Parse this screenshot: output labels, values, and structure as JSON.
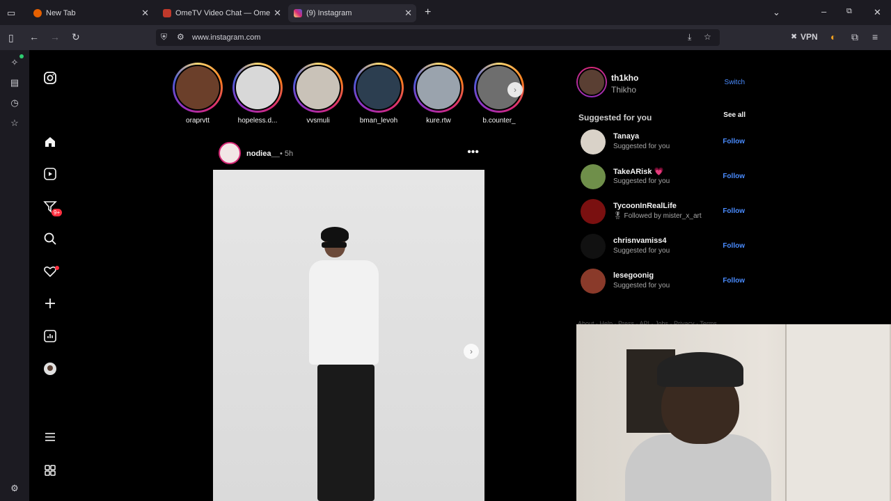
{
  "browser": {
    "tabs": [
      {
        "label": "New Tab",
        "favicon_color": "#e66000"
      },
      {
        "label": "OmeTV Video Chat — Omegle",
        "favicon_color": "#c0392b"
      },
      {
        "label": "(9) Instagram",
        "favicon_color": "#d62976"
      }
    ],
    "url": "www.instagram.com",
    "vpn_label": "VPN"
  },
  "instagram": {
    "notification_badge": "9+",
    "stories": [
      {
        "name": "oraprvtt",
        "color": "#6b3f2a"
      },
      {
        "name": "hopeless.d...",
        "color": "#d8d8d8"
      },
      {
        "name": "vvsmuli",
        "color": "#c9c2b8"
      },
      {
        "name": "bman_levoh",
        "color": "#2c3e50"
      },
      {
        "name": "kure.rtw",
        "color": "#9aa3ad"
      },
      {
        "name": "b.counter_",
        "color": "#6e6e6e"
      }
    ],
    "post": {
      "username": "nodiea__",
      "time": "• 5h"
    },
    "me": {
      "username": "th1kho",
      "full_name": "Thikho",
      "switch_label": "Switch"
    },
    "suggested": {
      "title": "Suggested for you",
      "see_all": "See all",
      "items": [
        {
          "username": "Tanaya",
          "sub": "Suggested for you",
          "follow": "Follow",
          "color": "#d9d2c8"
        },
        {
          "username": "TakeARisk 💗",
          "sub": "Suggested for you",
          "follow": "Follow",
          "color": "#6f8f4a"
        },
        {
          "username": "TycoonInRealLife",
          "sub": "🎖 Followed by mister_x_art",
          "follow": "Follow",
          "color": "#7a1010"
        },
        {
          "username": "chrisnvamiss4",
          "sub": "Suggested for you",
          "follow": "Follow",
          "color": "#111111"
        },
        {
          "username": "lesegoonig",
          "sub": "Suggested for you",
          "follow": "Follow",
          "color": "#8a3a2a"
        }
      ]
    },
    "footer_links": "About · Help · Press · API · Jobs · Privacy · Terms"
  }
}
